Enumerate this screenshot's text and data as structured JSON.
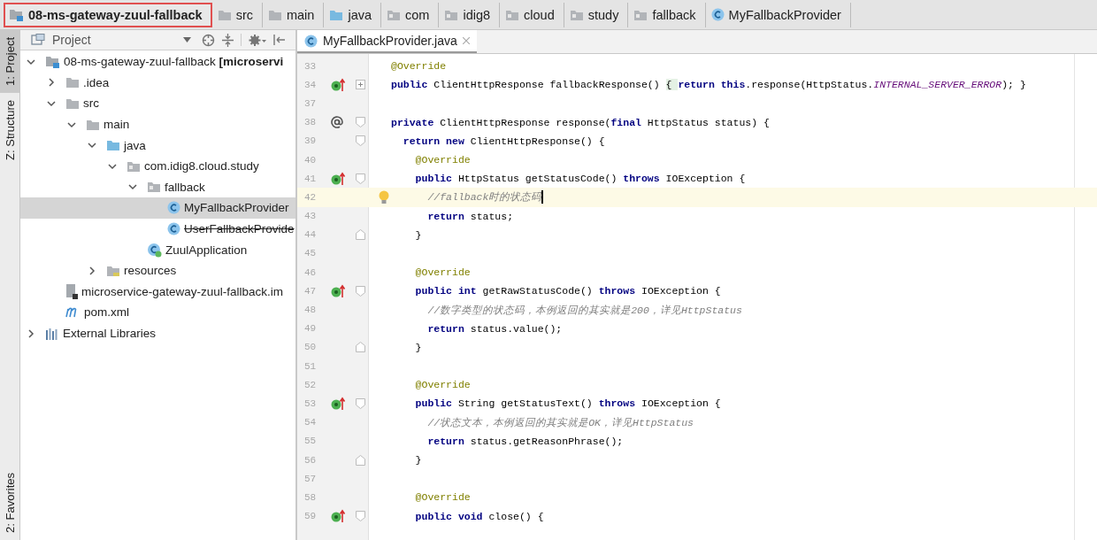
{
  "breadcrumbs": [
    {
      "label": "08-ms-gateway-zuul-fallback",
      "kind": "module",
      "selected": true
    },
    {
      "label": "src",
      "kind": "folder",
      "selected": false
    },
    {
      "label": "main",
      "kind": "folder",
      "selected": false
    },
    {
      "label": "java",
      "kind": "source-folder",
      "selected": false
    },
    {
      "label": "com",
      "kind": "package",
      "selected": false
    },
    {
      "label": "idig8",
      "kind": "package",
      "selected": false
    },
    {
      "label": "cloud",
      "kind": "package",
      "selected": false
    },
    {
      "label": "study",
      "kind": "package",
      "selected": false
    },
    {
      "label": "fallback",
      "kind": "package",
      "selected": false
    },
    {
      "label": "MyFallbackProvider",
      "kind": "class",
      "selected": false
    }
  ],
  "tool_tabs": [
    {
      "label": "1: Project",
      "selected": true
    },
    {
      "label": "Z: Structure",
      "selected": false
    },
    {
      "label": "2: Favorites",
      "selected": false
    }
  ],
  "project_panel": {
    "title": "Project",
    "tree": [
      {
        "label": "08-ms-gateway-zuul-fallback **[microservi**",
        "kind": "module",
        "expanded": true,
        "selected": false,
        "deprecated": false,
        "children": [
          {
            "label": ".idea",
            "kind": "folder",
            "expanded": false,
            "selected": false,
            "deprecated": false
          },
          {
            "label": "src",
            "kind": "folder",
            "expanded": true,
            "selected": false,
            "deprecated": false,
            "children": [
              {
                "label": "main",
                "kind": "folder",
                "expanded": true,
                "selected": false,
                "deprecated": false,
                "children": [
                  {
                    "label": "java",
                    "kind": "source-folder",
                    "expanded": true,
                    "selected": false,
                    "deprecated": false,
                    "children": [
                      {
                        "label": "com.idig8.cloud.study",
                        "kind": "package",
                        "expanded": true,
                        "selected": false,
                        "deprecated": false,
                        "children": [
                          {
                            "label": "fallback",
                            "kind": "package",
                            "expanded": true,
                            "selected": false,
                            "deprecated": false,
                            "children": [
                              {
                                "label": "MyFallbackProvider",
                                "kind": "class",
                                "selected": true,
                                "deprecated": false
                              },
                              {
                                "label": "UserFallbackProvide",
                                "kind": "class",
                                "selected": false,
                                "deprecated": true
                              }
                            ]
                          },
                          {
                            "label": "ZuulApplication",
                            "kind": "spring-class",
                            "selected": false,
                            "deprecated": false
                          }
                        ]
                      }
                    ]
                  },
                  {
                    "label": "resources",
                    "kind": "resource-folder",
                    "expanded": false,
                    "selected": false,
                    "deprecated": false
                  }
                ]
              }
            ]
          },
          {
            "label": "microservice-gateway-zuul-fallback.im",
            "kind": "module-file",
            "selected": false,
            "deprecated": false
          },
          {
            "label": "pom.xml",
            "kind": "maven",
            "selected": false,
            "deprecated": false
          }
        ]
      },
      {
        "label": "External Libraries",
        "kind": "libraries",
        "expanded": false,
        "selected": false,
        "deprecated": false
      }
    ]
  },
  "editor": {
    "tabs": [
      {
        "label": "MyFallbackProvider.java",
        "kind": "class",
        "selected": true
      }
    ],
    "lines": [
      {
        "n": "33",
        "current": false,
        "bulb": false,
        "tokens": [
          {
            "kind": "ann",
            "text": "@Override"
          }
        ]
      },
      {
        "n": "34",
        "gutter": {
          "kind": "override"
        },
        "fold": {
          "kind": "plus"
        },
        "current": false,
        "bulb": false,
        "tokens": [
          {
            "kind": "kw",
            "text": "public"
          },
          {
            "kind": "plain",
            "text": " ClientHttpResponse fallbackResponse() "
          },
          {
            "kind": "folded",
            "text": "{ "
          },
          {
            "kind": "kw",
            "text": "return this"
          },
          {
            "kind": "plain",
            "text": ".response(HttpStatus."
          },
          {
            "kind": "const",
            "text": "INTERNAL_SERVER_ERROR"
          },
          {
            "kind": "plain",
            "text": "); }"
          }
        ]
      },
      {
        "n": "37",
        "current": false,
        "bulb": false
      },
      {
        "n": "38",
        "gutter": {
          "kind": "at"
        },
        "fold": {
          "kind": "open"
        },
        "current": false,
        "bulb": false,
        "tokens": [
          {
            "kind": "kw",
            "text": "private"
          },
          {
            "kind": "plain",
            "text": " ClientHttpResponse response("
          },
          {
            "kind": "kw",
            "text": "final"
          },
          {
            "kind": "plain",
            "text": " HttpStatus status) {"
          }
        ]
      },
      {
        "n": "39",
        "fold": {
          "kind": "open"
        },
        "current": false,
        "bulb": false,
        "tokens": [
          {
            "kind": "kw",
            "text": "  return new"
          },
          {
            "kind": "plain",
            "text": " ClientHttpResponse() {"
          }
        ]
      },
      {
        "n": "40",
        "current": false,
        "bulb": false,
        "tokens": [
          {
            "kind": "ann",
            "text": "    @Override"
          }
        ]
      },
      {
        "n": "41",
        "gutter": {
          "kind": "override"
        },
        "fold": {
          "kind": "open"
        },
        "current": false,
        "bulb": false,
        "tokens": [
          {
            "kind": "kw",
            "text": "    public"
          },
          {
            "kind": "plain",
            "text": " HttpStatus getStatusCode() "
          },
          {
            "kind": "kw",
            "text": "throws"
          },
          {
            "kind": "plain",
            "text": " IOException {"
          }
        ]
      },
      {
        "n": "42",
        "current": true,
        "bulb": true,
        "tokens": [
          {
            "kind": "cmt",
            "text": "      //fallback时的状态码"
          }
        ]
      },
      {
        "n": "43",
        "current": false,
        "bulb": false,
        "tokens": [
          {
            "kind": "kw",
            "text": "      return"
          },
          {
            "kind": "plain",
            "text": " status;"
          }
        ]
      },
      {
        "n": "44",
        "fold": {
          "kind": "close"
        },
        "current": false,
        "bulb": false,
        "tokens": [
          {
            "kind": "plain",
            "text": "    }"
          }
        ]
      },
      {
        "n": "45",
        "current": false,
        "bulb": false
      },
      {
        "n": "46",
        "current": false,
        "bulb": false,
        "tokens": [
          {
            "kind": "ann",
            "text": "    @Override"
          }
        ]
      },
      {
        "n": "47",
        "gutter": {
          "kind": "override"
        },
        "fold": {
          "kind": "open"
        },
        "current": false,
        "bulb": false,
        "tokens": [
          {
            "kind": "kw",
            "text": "    public int"
          },
          {
            "kind": "plain",
            "text": " getRawStatusCode() "
          },
          {
            "kind": "kw",
            "text": "throws"
          },
          {
            "kind": "plain",
            "text": " IOException {"
          }
        ]
      },
      {
        "n": "48",
        "current": false,
        "bulb": false,
        "tokens": [
          {
            "kind": "cmt",
            "text": "      //数字类型的状态码，本例返回的其实就是200，详见HttpStatus"
          }
        ]
      },
      {
        "n": "49",
        "current": false,
        "bulb": false,
        "tokens": [
          {
            "kind": "kw",
            "text": "      return"
          },
          {
            "kind": "plain",
            "text": " status.value();"
          }
        ]
      },
      {
        "n": "50",
        "fold": {
          "kind": "close"
        },
        "current": false,
        "bulb": false,
        "tokens": [
          {
            "kind": "plain",
            "text": "    }"
          }
        ]
      },
      {
        "n": "51",
        "current": false,
        "bulb": false
      },
      {
        "n": "52",
        "current": false,
        "bulb": false,
        "tokens": [
          {
            "kind": "ann",
            "text": "    @Override"
          }
        ]
      },
      {
        "n": "53",
        "gutter": {
          "kind": "override"
        },
        "fold": {
          "kind": "open"
        },
        "current": false,
        "bulb": false,
        "tokens": [
          {
            "kind": "kw",
            "text": "    public"
          },
          {
            "kind": "plain",
            "text": " String getStatusText() "
          },
          {
            "kind": "kw",
            "text": "throws"
          },
          {
            "kind": "plain",
            "text": " IOException {"
          }
        ]
      },
      {
        "n": "54",
        "current": false,
        "bulb": false,
        "tokens": [
          {
            "kind": "cmt",
            "text": "      //状态文本，本例返回的其实就是OK，详见HttpStatus"
          }
        ]
      },
      {
        "n": "55",
        "current": false,
        "bulb": false,
        "tokens": [
          {
            "kind": "kw",
            "text": "      return"
          },
          {
            "kind": "plain",
            "text": " status.getReasonPhrase();"
          }
        ]
      },
      {
        "n": "56",
        "fold": {
          "kind": "close"
        },
        "current": false,
        "bulb": false,
        "tokens": [
          {
            "kind": "plain",
            "text": "    }"
          }
        ]
      },
      {
        "n": "57",
        "current": false,
        "bulb": false
      },
      {
        "n": "58",
        "current": false,
        "bulb": false,
        "tokens": [
          {
            "kind": "ann",
            "text": "    @Override"
          }
        ]
      },
      {
        "n": "59",
        "gutter": {
          "kind": "override"
        },
        "fold": {
          "kind": "open"
        },
        "current": false,
        "bulb": false,
        "tokens": [
          {
            "kind": "kw",
            "text": "    public void"
          },
          {
            "kind": "plain",
            "text": " close() {"
          }
        ]
      }
    ]
  }
}
